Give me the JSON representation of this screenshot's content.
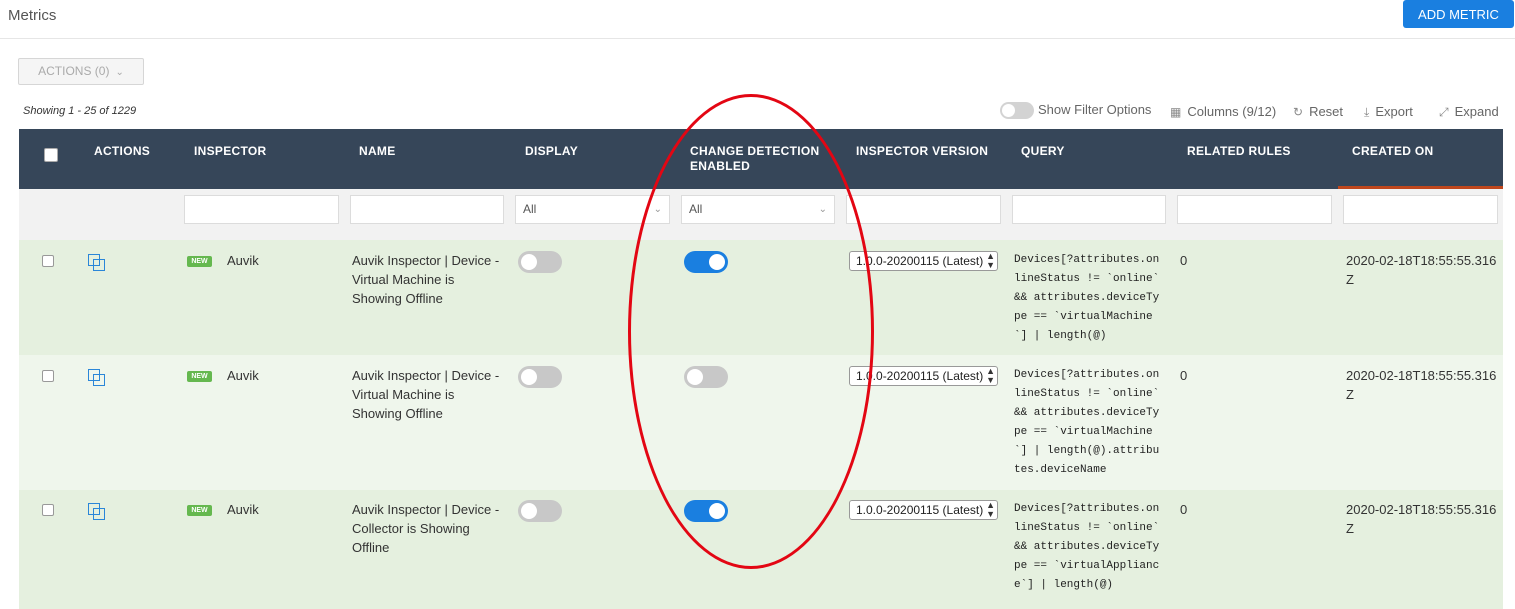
{
  "header": {
    "title": "Metrics",
    "add_button": "ADD METRIC"
  },
  "actions_button": {
    "label": "ACTIONS (0)"
  },
  "showing": "Showing 1 - 25 of 1229",
  "toolbar": {
    "filter_toggle_label": "Show Filter Options",
    "columns": "Columns (9/12)",
    "reset": "Reset",
    "export": "Export",
    "expand": "Expand"
  },
  "columns": {
    "actions": "ACTIONS",
    "inspector": "INSPECTOR",
    "name": "NAME",
    "display": "DISPLAY",
    "change_detection_1": "CHANGE DETECTION",
    "change_detection_2": "ENABLED",
    "inspector_version": "INSPECTOR VERSION",
    "query": "QUERY",
    "related_rules": "RELATED RULES",
    "created_on": "CREATED ON"
  },
  "filters": {
    "display": "All",
    "change_detection": "All"
  },
  "rows": [
    {
      "badge": "NEW",
      "inspector": "Auvik",
      "name": "Auvik Inspector | Device - Virtual Machine is Showing Offline",
      "display_enabled": false,
      "change_detection_enabled": true,
      "version": "1.0.0-20200115 (Latest)",
      "query": "Devices[?attributes.onlineStatus != `online` && attributes.deviceType == `virtualMachine`] | length(@)",
      "related_rules": "0",
      "created_on": "2020-02-18T18:55:55.316Z"
    },
    {
      "badge": "NEW",
      "inspector": "Auvik",
      "name": "Auvik Inspector | Device - Virtual Machine is Showing Offline",
      "display_enabled": false,
      "change_detection_enabled": false,
      "version": "1.0.0-20200115 (Latest)",
      "query": "Devices[?attributes.onlineStatus != `online` && attributes.deviceType == `virtualMachine`] | length(@).attributes.deviceName",
      "related_rules": "0",
      "created_on": "2020-02-18T18:55:55.316Z"
    },
    {
      "badge": "NEW",
      "inspector": "Auvik",
      "name": "Auvik Inspector | Device - Collector is Showing Offline",
      "display_enabled": false,
      "change_detection_enabled": true,
      "version": "1.0.0-20200115 (Latest)",
      "query": "Devices[?attributes.onlineStatus != `online` && attributes.deviceType == `virtualAppliance`] | length(@)",
      "related_rules": "0",
      "created_on": "2020-02-18T18:55:55.316Z"
    }
  ],
  "annotation": {
    "shape": "ellipse",
    "color": "#e30613"
  }
}
